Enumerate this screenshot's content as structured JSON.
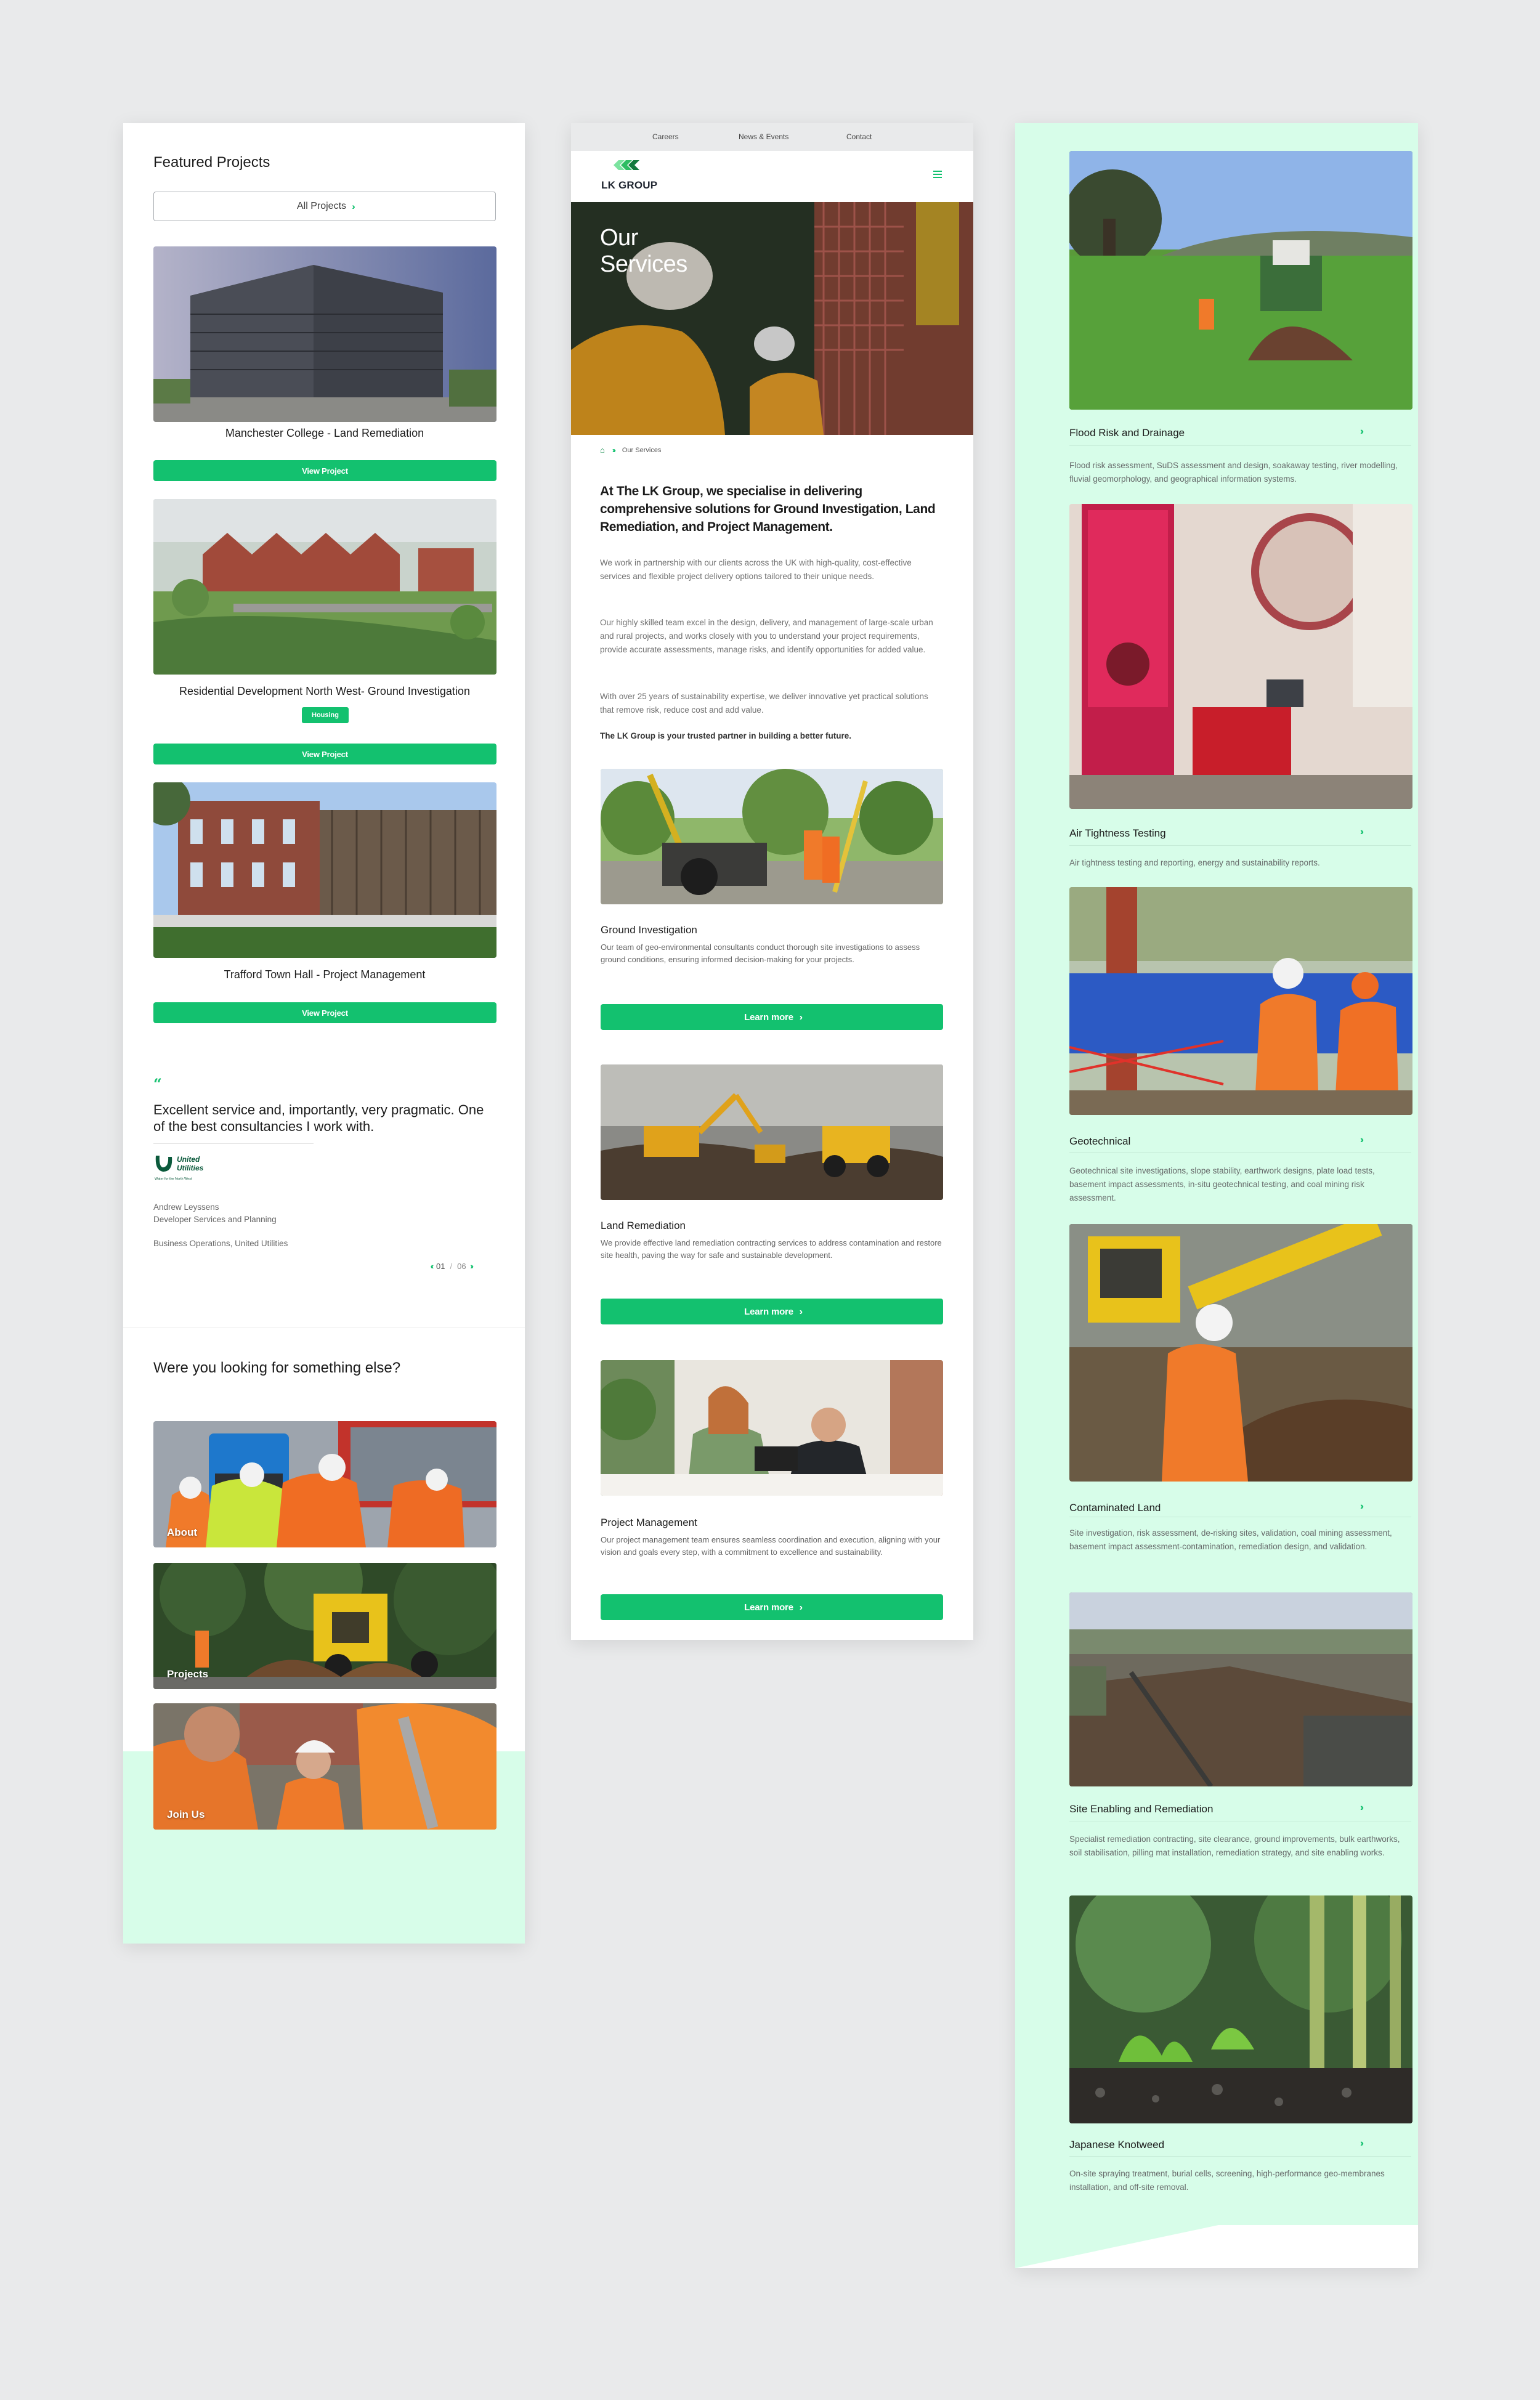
{
  "colors": {
    "accent": "#13c16f",
    "mint": "#d7fde9",
    "page_bg": "#e9eaeb"
  },
  "left": {
    "featured_title": "Featured Projects",
    "all_projects_label": "All Projects",
    "projects": [
      {
        "title": "Manchester College - Land Remediation",
        "button": "View Project",
        "tag": null
      },
      {
        "title": "Residential Development North West- Ground Investigation",
        "button": "View Project",
        "tag": "Housing"
      },
      {
        "title": "Trafford Town Hall - Project Management",
        "button": "View Project",
        "tag": null
      }
    ],
    "testimonial": {
      "quote_mark": "“",
      "text": "Excellent service and, importantly, very pragmatic. One of the best consultancies I work with.",
      "logo": {
        "name": "United",
        "name2": "Utilities",
        "tagline": "Water for the North West"
      },
      "person_name": "Andrew Leyssens",
      "person_role": "Developer Services and Planning",
      "person_org": "Business Operations, United Utilities",
      "pager_current": "01",
      "pager_sep": "/",
      "pager_total": "06"
    },
    "looking_title": "Were you looking for something else?",
    "tiles": [
      {
        "label": "About"
      },
      {
        "label": "Projects"
      },
      {
        "label": "Join Us"
      }
    ]
  },
  "mid": {
    "top_nav": [
      "Careers",
      "News & Events",
      "Contact"
    ],
    "logo_text": "LK GROUP",
    "hero_title_1": "Our",
    "hero_title_2": "Services",
    "breadcrumb_current": "Our Services",
    "intro_heading": "At The LK Group, we specialise in delivering comprehensive solutions for Ground Investigation, Land Remediation, and Project Management.",
    "intro_paragraphs": [
      "We work in partnership with our clients across the UK with high-quality, cost-effective services and flexible project delivery options tailored to their unique needs.",
      "Our highly skilled team excel in the design, delivery, and management of large-scale urban and rural projects, and works closely with you to understand your project requirements, provide accurate assessments, manage risks, and identify opportunities for added value.",
      "With over 25 years of sustainability expertise, we deliver innovative yet practical solutions that remove risk, reduce cost and add value."
    ],
    "intro_bold": "The LK Group is your trusted partner in building a better future.",
    "services": [
      {
        "title": "Ground Investigation",
        "desc": "Our team of geo-environmental consultants conduct thorough site investigations to assess ground conditions, ensuring informed decision-making for your projects.",
        "button": "Learn more"
      },
      {
        "title": "Land Remediation",
        "desc": "We provide effective land remediation contracting services to address contamination and restore site health, paving the way for safe and sustainable development.",
        "button": "Learn more"
      },
      {
        "title": "Project Management",
        "desc": "Our project management team ensures seamless coordination and execution, aligning with your vision and goals every step, with a commitment to excellence and sustainability.",
        "button": "Learn more"
      }
    ]
  },
  "right": {
    "services": [
      {
        "title": "Flood Risk and Drainage",
        "desc": "Flood risk assessment, SuDS assessment and design, soakaway testing, river modelling, fluvial geomorphology, and geographical information systems."
      },
      {
        "title": "Air Tightness Testing",
        "desc": "Air tightness testing and reporting, energy and sustainability reports."
      },
      {
        "title": "Geotechnical",
        "desc": "Geotechnical site investigations, slope stability, earthwork designs, plate load tests, basement impact assessments, in-situ geotechnical testing, and coal mining risk assessment."
      },
      {
        "title": "Contaminated Land",
        "desc": "Site investigation, risk assessment, de-risking sites, validation, coal mining assessment, basement impact assessment-contamination, remediation design, and validation."
      },
      {
        "title": "Site Enabling and Remediation",
        "desc": "Specialist remediation contracting, site clearance, ground improvements, bulk earthworks, soil stabilisation, pilling mat installation, remediation strategy, and site enabling works."
      },
      {
        "title": "Japanese Knotweed",
        "desc": "On-site spraying treatment, burial cells, screening, high-performance geo-membranes installation, and off-site removal."
      }
    ]
  }
}
